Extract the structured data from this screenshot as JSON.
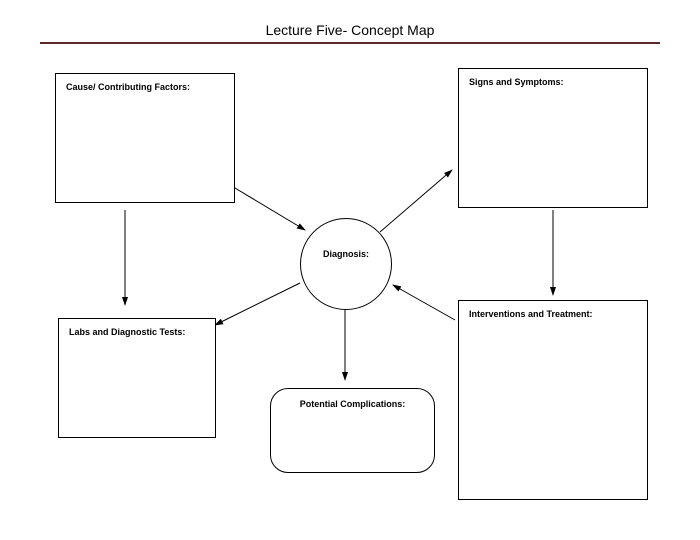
{
  "title": "Lecture Five- Concept Map",
  "nodes": {
    "cause": "Cause/ Contributing Factors:",
    "signs": "Signs and Symptoms:",
    "diagnosis": "Diagnosis:",
    "labs": "Labs and Diagnostic Tests:",
    "interventions": "Interventions and Treatment:",
    "complications": "Potential Complications:"
  }
}
